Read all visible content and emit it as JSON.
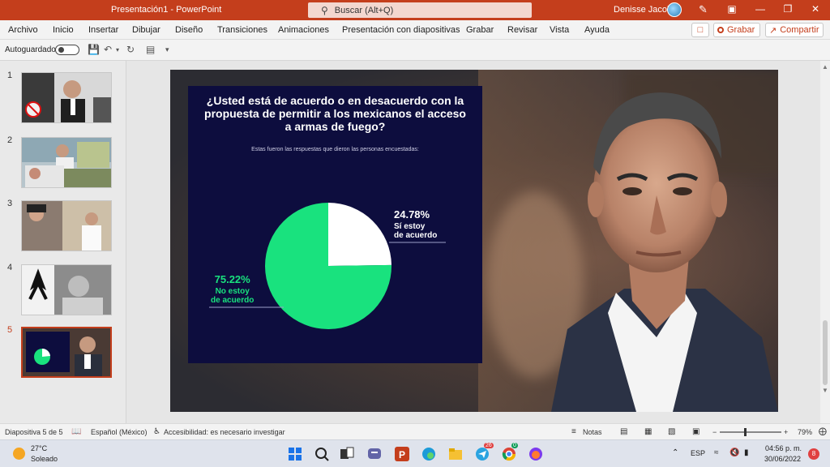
{
  "app": {
    "window_title": "Presentación1  -  PowerPoint",
    "search_placeholder": "Buscar (Alt+Q)",
    "user_name": "Denisse Jacobo"
  },
  "ribbon": {
    "tabs": [
      "Archivo",
      "Inicio",
      "Insertar",
      "Dibujar",
      "Diseño",
      "Transiciones",
      "Animaciones",
      "Presentación con diapositivas",
      "Grabar",
      "Revisar",
      "Vista",
      "Ayuda"
    ],
    "record_label": "Grabar",
    "share_label": "Compartir"
  },
  "qat": {
    "autosave_label": "Autoguardado"
  },
  "slides_panel": {
    "numbers": [
      "1",
      "2",
      "3",
      "4",
      "5"
    ],
    "selected": 5
  },
  "slide": {
    "question": "¿Usted está de acuerdo o en desacuerdo con la propuesta de permitir a los mexicanos el acceso a armas de fuego?",
    "subtitle": "Estas fueron las respuestas que dieron las personas encuestadas:",
    "colors": {
      "card": "#0d0d3e",
      "agree": "#ffffff",
      "disagree": "#19e27e"
    }
  },
  "chart_data": {
    "type": "pie",
    "title": "¿Usted está de acuerdo o en desacuerdo con la propuesta de permitir a los mexicanos el acceso a armas de fuego?",
    "subtitle": "Estas fueron las respuestas que dieron las personas encuestadas:",
    "slices": [
      {
        "label": "Sí estoy de acuerdo",
        "label_lines": [
          "Sí estoy",
          "de acuerdo"
        ],
        "value": 24.78,
        "value_label": "24.78%",
        "color": "#ffffff"
      },
      {
        "label": "No estoy de acuerdo",
        "label_lines": [
          "No estoy",
          "de acuerdo"
        ],
        "value": 75.22,
        "value_label": "75.22%",
        "color": "#19e27e"
      }
    ]
  },
  "status": {
    "slide_info": "Diapositiva 5 de 5",
    "language": "Español (México)",
    "accessibility": "Accesibilidad: es necesario investigar",
    "notes": "Notas",
    "zoom": "79%"
  },
  "taskbar": {
    "temp": "27°C",
    "weather": "Soleado",
    "lang": "ESP",
    "time": "04:56 p. m.",
    "date": "30/06/2022",
    "notif_count": "8",
    "telegram_badge": "26",
    "chrome_badge": "0"
  }
}
